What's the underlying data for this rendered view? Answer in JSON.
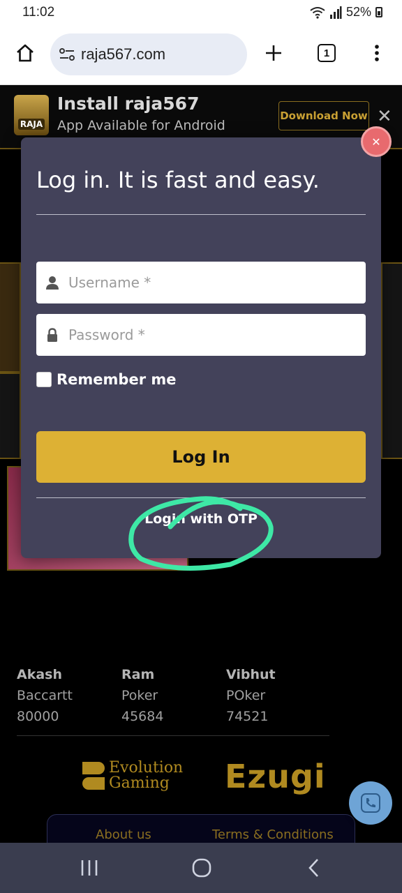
{
  "status_bar": {
    "time": "11:02",
    "battery": "52%"
  },
  "browser": {
    "url": "raja567.com",
    "tab_count": "1"
  },
  "install_banner": {
    "logo_text": "RAJA",
    "title": "Install raja567",
    "subtitle": "App Available for Android",
    "download_label": "Download Now"
  },
  "login_modal": {
    "title": "Log in. It is fast and easy.",
    "username_placeholder": "Username *",
    "password_placeholder": "Password *",
    "remember_label": "Remember me",
    "login_label": "Log In",
    "otp_label": "Login with OTP"
  },
  "stats": [
    {
      "name": "Akash",
      "game": "Baccartt",
      "amount": "80000"
    },
    {
      "name": "Ram",
      "game": "Poker",
      "amount": "45684"
    },
    {
      "name": "Vibhut",
      "game": "POker",
      "amount": "74521"
    }
  ],
  "providers": {
    "evolution_line1": "Evolution",
    "evolution_line2": "Gaming",
    "ezugi": "Ezugi"
  },
  "footer": {
    "about": "About us",
    "terms": "Terms & Conditions"
  },
  "colors": {
    "gold": "#ddb134",
    "modal_bg": "#43425a",
    "annotation": "#3ee8a6"
  }
}
